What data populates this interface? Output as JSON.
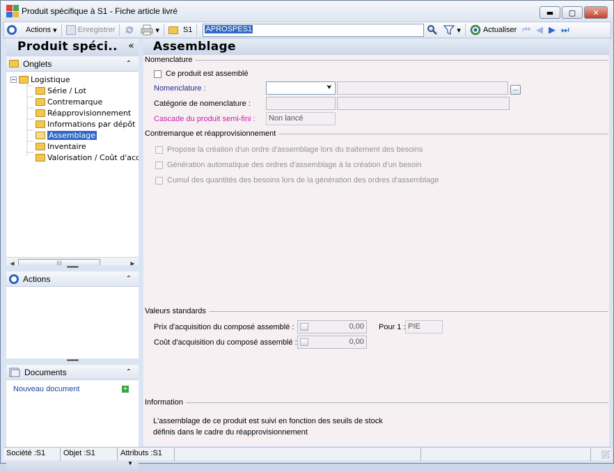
{
  "window": {
    "title": "Produit spécifique à S1 -  Fiche article livré",
    "min_glyph": "▬",
    "max_glyph": "▢",
    "close_glyph": "✕"
  },
  "toolbar": {
    "actions_label": "Actions",
    "save_label": "Enregistrer",
    "site_label": "S1",
    "code_value": "APROSPES1",
    "refresh_label": "Actualiser",
    "dropdown_glyph": "▾"
  },
  "left_panel": {
    "title": "Produit spéci..",
    "collapse_glyph": "«",
    "tabs_header": "Onglets",
    "chevron_glyph": "⌃",
    "tree": {
      "root": "Logistique",
      "children": [
        "Série / Lot",
        "Contremarque",
        "Réapprovisionnement",
        "Informations par dépôt",
        "Assemblage",
        "Inventaire",
        "Valorisation / Coût d'acquisition"
      ],
      "selected": "Assemblage"
    },
    "actions_header": "Actions",
    "documents_header": "Documents",
    "new_document": "Nouveau document",
    "splitter_dots": "•••••••••",
    "bottom_glyph": "▼"
  },
  "main": {
    "title": "Assemblage",
    "nomenclature_group": "Nomenclature",
    "assembled_checkbox": "Ce produit est assemblé",
    "nomenclature_label": "Nomenclature :",
    "category_label": "Catégorie de nomenclature :",
    "cascade_label": "Cascade du produit semi-fini :",
    "cascade_value": "Non lancé",
    "ellipsis": "...",
    "combo_glyph": "⮟",
    "contremarque_group": "Contremarque et réapprovisionnement",
    "options": [
      "Propose la création d'un ordre d'assemblage lors du traitement des besoins",
      "Génération automatique des ordres d'assemblage à la création d'un besoin",
      "Cumul des quantités des besoins lors de la génération des ordres d'assemblage"
    ],
    "standards_group": "Valeurs standards",
    "prix_label": "Prix d'acquisition du composé assemblé :",
    "prix_value": "0,00",
    "pour_label": "Pour 1 :",
    "pour_value": "PIE",
    "cout_label": "Coût d'acquisition du composé assemblé :",
    "cout_value": "0,00",
    "information_group": "Information",
    "info_line1": "L'assemblage de ce produit est suivi en fonction des seuils de stock",
    "info_line2": "définis dans le cadre du réapprovisionnement"
  },
  "statusbar": {
    "societe": "Société :S1",
    "objet": "Objet :S1",
    "attributs": "Attributs :S1"
  },
  "colors": {
    "accent": "#3168c4",
    "magenta_label": "#c91fa8",
    "blue_label": "#1d2c8f"
  }
}
